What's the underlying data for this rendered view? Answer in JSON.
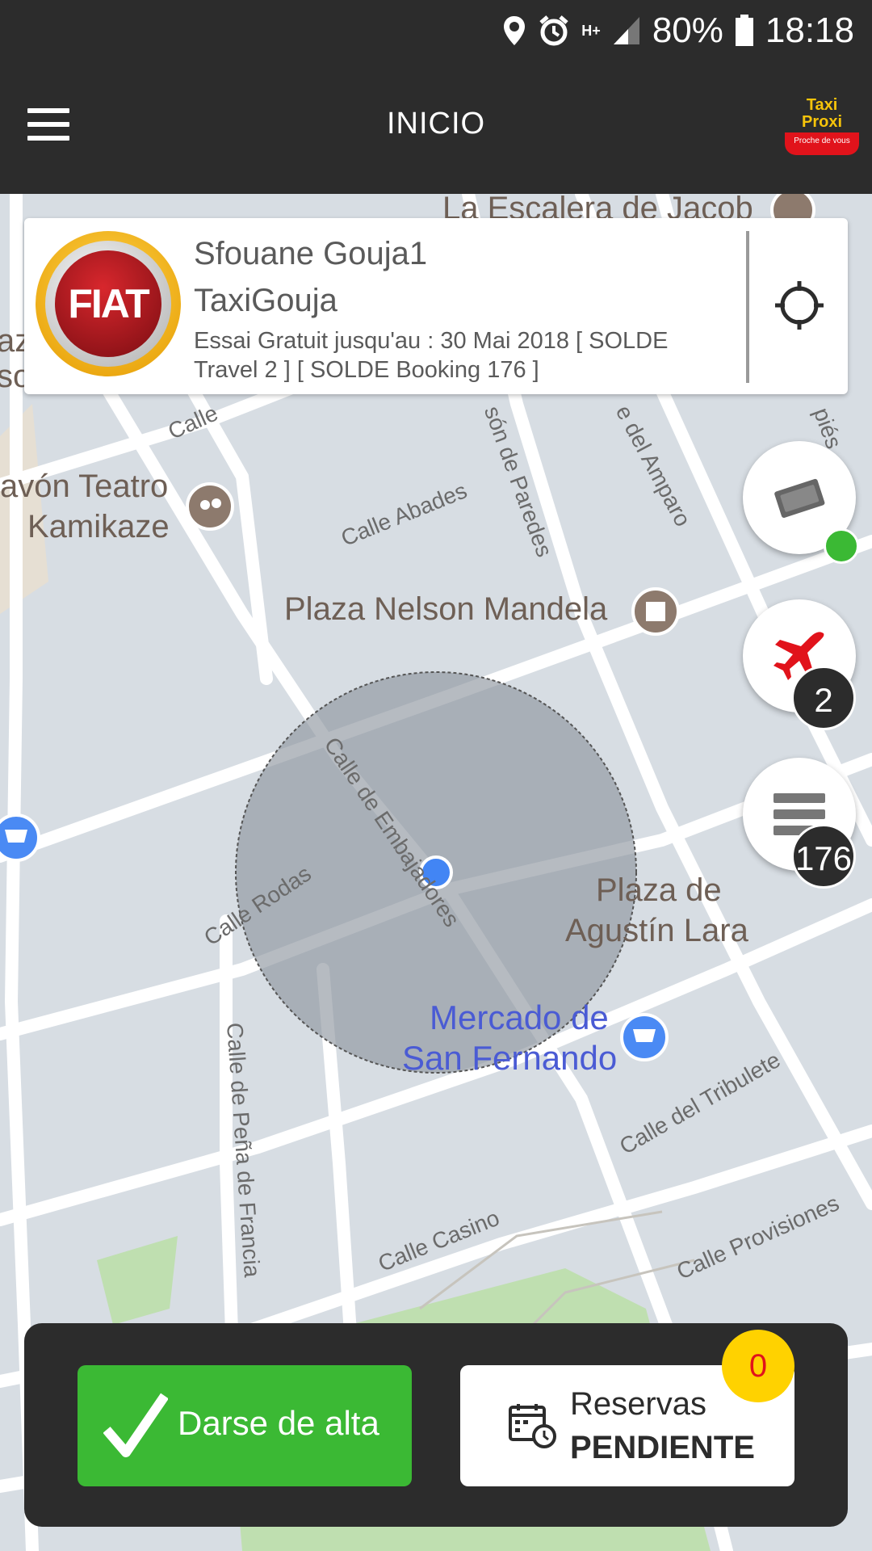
{
  "status_bar": {
    "battery": "80%",
    "time": "18:18",
    "network": "H+"
  },
  "app_bar": {
    "title": "INICIO",
    "logo_line1": "Taxi",
    "logo_line2": "Proxi",
    "logo_tagline": "Proche de vous"
  },
  "driver": {
    "name": "Sfouane Gouja1",
    "company": "TaxiGouja",
    "trial_text": "Essai Gratuit jusqu'au : 30 Mai 2018 [ SOLDE Travel 2 ]   [ SOLDE Booking 176 ]",
    "brand_logo_text": "FIAT"
  },
  "map": {
    "labels": {
      "escalera": "La Escalera de Jacob",
      "teatro_1": "avón Teatro",
      "teatro_2": "Kamikaze",
      "plaza_mandela": "Plaza Nelson Mandela",
      "plaza_agustin_1": "Plaza de",
      "plaza_agustin_2": "Agustín Lara",
      "mercado_1": "Mercado de",
      "mercado_2": "San Fernando",
      "calle_abades": "Calle Abades",
      "calle_paredes": "són de Paredes",
      "calle_amparo": "e del Amparo",
      "calle_embajadores": "Calle de Embajadores",
      "calle_rodas": "Calle Rodas",
      "calle_pena": "Calle de Peña de Francia",
      "calle_tribulete": "Calle del Tribulete",
      "calle_casino": "Calle Casino",
      "calle_provisiones": "Calle Provisiones",
      "calle_top": "Calle",
      "calle_pies": "piés",
      "edge_az": "az",
      "edge_so": "so"
    }
  },
  "fabs": {
    "travel_count": "2",
    "booking_count": "176"
  },
  "bottom": {
    "alta_label": "Darse de alta",
    "reservas_line1": "Reservas",
    "reservas_line2": "PENDIENTE",
    "reservas_count": "0"
  },
  "colors": {
    "bar_bg": "#2c2c2c",
    "green": "#3bb934",
    "badge_yellow": "#ffd200",
    "accent_red": "#e1131b",
    "map_bg": "#d7dde3"
  }
}
